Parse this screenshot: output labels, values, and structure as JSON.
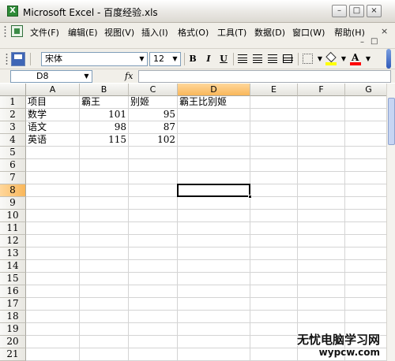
{
  "window": {
    "title": "Microsoft Excel - 百度经验.xls",
    "app_icon": "excel-icon"
  },
  "menu": {
    "items": [
      "文件(F)",
      "编辑(E)",
      "视图(V)",
      "插入(I)",
      "格式(O)",
      "工具(T)",
      "数据(D)",
      "窗口(W)",
      "帮助(H)"
    ]
  },
  "toolbar": {
    "font_name": "宋体",
    "font_size": "12",
    "bold_label": "B",
    "italic_label": "I",
    "underline_label": "U",
    "font_color_label": "A",
    "accent_fill": "#ffff00",
    "accent_font": "#ff0000"
  },
  "formula_bar": {
    "name_box": "D8",
    "fx_label": "fx",
    "formula": ""
  },
  "sheet": {
    "columns": [
      "A",
      "B",
      "C",
      "D",
      "E",
      "F",
      "G"
    ],
    "rows": [
      "1",
      "2",
      "3",
      "4",
      "5",
      "6",
      "7",
      "8",
      "9",
      "10",
      "11",
      "12",
      "13",
      "14",
      "15",
      "16",
      "17",
      "18",
      "19",
      "20",
      "21"
    ],
    "selected_column": "D",
    "selected_row": "8",
    "cells": {
      "A1": "项目",
      "B1": "霸王",
      "C1": "别姬",
      "D1": "霸王比别姬",
      "A2": "数学",
      "B2": "101",
      "C2": "95",
      "A3": "语文",
      "B3": "98",
      "C3": "87",
      "A4": "英语",
      "B4": "115",
      "C4": "102"
    }
  },
  "watermark": {
    "line1": "无忧电脑学习网",
    "line2": "wypcw.com"
  }
}
